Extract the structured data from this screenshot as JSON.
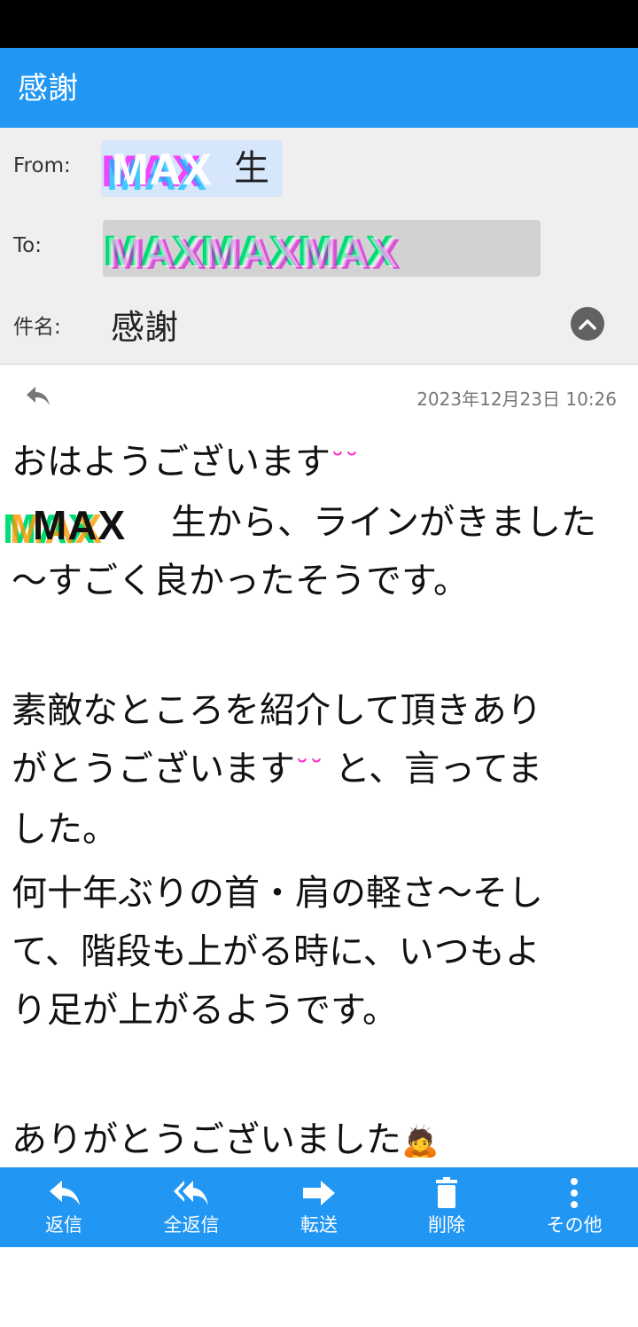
{
  "app_bar": {
    "title": "感謝"
  },
  "header": {
    "from_label": "From:",
    "from_value": "生",
    "from_redact": "MAX",
    "to_label": "To:",
    "to_redact": "MAXMAXMAX",
    "subject_label": "件名:",
    "subject": "感謝"
  },
  "meta": {
    "date": "2023年12月23日 10:26"
  },
  "body": {
    "line1": "おはようございます",
    "smile1": "˘˘",
    "name_redact": "MAX",
    "line2": "生から、ラインがきました",
    "line3": "〜すごく良かったそうです。",
    "line4": "素敵なところを紹介して頂きあり",
    "line5a": "がとうございます",
    "smile2": "˘˘",
    "line5b": " と、言ってま",
    "line6": "した。",
    "line7": "何十年ぶりの首・肩の軽さ〜そし",
    "line8": "て、階段も上がる時に、いつもよ",
    "line9": "り足が上がるようです。",
    "line10": "ありがとうございました",
    "bow": "🙇"
  },
  "bottom_bar": {
    "reply": "返信",
    "reply_all": "全返信",
    "forward": "転送",
    "delete": "削除",
    "more": "その他"
  },
  "colors": {
    "primary": "#2196F3",
    "header_bg": "#efefef"
  }
}
